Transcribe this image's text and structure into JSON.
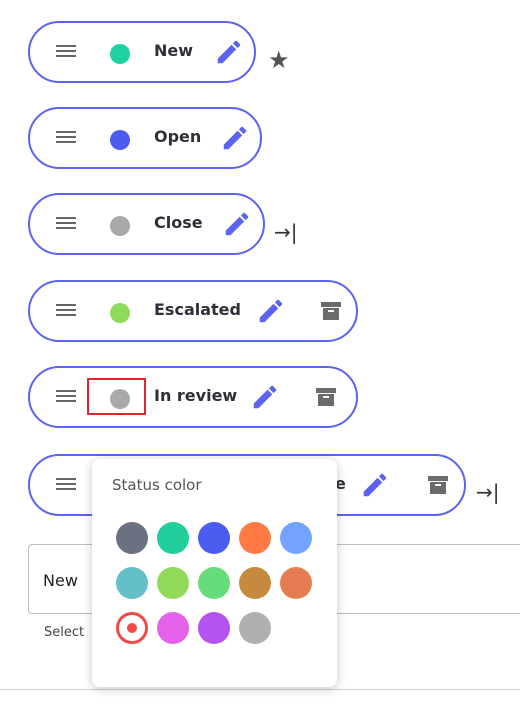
{
  "statuses": [
    {
      "label": "New",
      "color": "#1dd1a1"
    },
    {
      "label": "Open",
      "color": "#4b5cf0"
    },
    {
      "label": "Close",
      "color": "#a9a9a9"
    },
    {
      "label": "Escalated",
      "color": "#8fdc5a"
    },
    {
      "label": "In review",
      "color": "#a9a9a9"
    },
    {
      "label": "e",
      "color": ""
    }
  ],
  "icons": {
    "drag": "drag-handle-icon",
    "pencil": "pencil-icon",
    "archive": "archive-icon",
    "star": "★",
    "move_to_end": "→|"
  },
  "accent_color": "#5c63f0",
  "popup": {
    "title": "Status color",
    "swatches": [
      [
        "#6b7180",
        "#20cf9b",
        "#4b5cf0",
        "#ff7a45",
        "#73a2ff"
      ],
      [
        "#63c0c9",
        "#92d85a",
        "#66dc7a",
        "#c58a3e",
        "#e57c52"
      ],
      [
        "#f04a4a",
        "#e462ea",
        "#b553f0",
        "#b0b0b0"
      ]
    ],
    "selected_color": "#f04a4a"
  },
  "form": {
    "value": "New",
    "helper": "Select"
  }
}
